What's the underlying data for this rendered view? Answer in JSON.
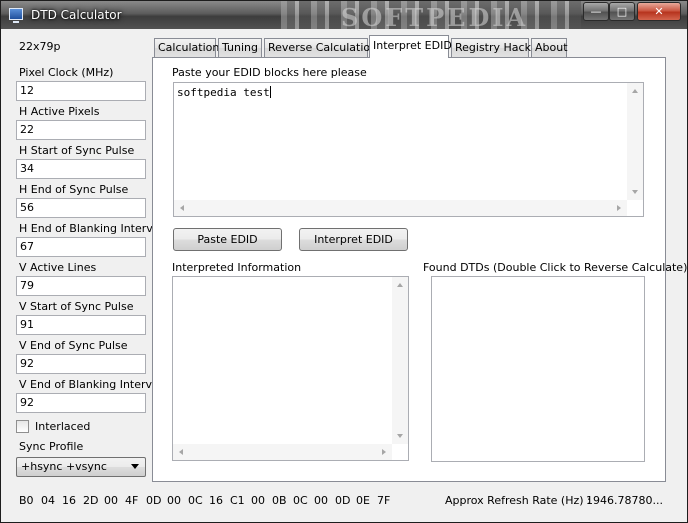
{
  "window": {
    "title": "DTD Calculator",
    "watermark": "SOFTPEDIA",
    "controls": {
      "minimize": "—",
      "maximize": "□",
      "close": "✕"
    }
  },
  "left_panel": {
    "mode_label": "22x79p",
    "fields": [
      {
        "label": "Pixel Clock (MHz)",
        "value": "12"
      },
      {
        "label": "H Active Pixels",
        "value": "22"
      },
      {
        "label": "H Start of Sync Pulse",
        "value": "34"
      },
      {
        "label": "H End of Sync Pulse",
        "value": "56"
      },
      {
        "label": "H End of Blanking Interval",
        "value": "67"
      },
      {
        "label": "V Active Lines",
        "value": "79"
      },
      {
        "label": "V Start of Sync Pulse",
        "value": "91"
      },
      {
        "label": "V End of Sync Pulse",
        "value": "92"
      },
      {
        "label": "V End of Blanking Interval",
        "value": "92"
      }
    ],
    "interlaced_label": "Interlaced",
    "interlaced_checked": false,
    "sync_profile_label": "Sync Profile",
    "sync_profile_value": "+hsync +vsync"
  },
  "tabs": [
    {
      "label": "Calculation",
      "active": false
    },
    {
      "label": "Tuning",
      "active": false
    },
    {
      "label": "Reverse Calculation",
      "active": false
    },
    {
      "label": "Interpret EDID",
      "active": true
    },
    {
      "label": "Registry Hack",
      "active": false
    },
    {
      "label": "About",
      "active": false
    }
  ],
  "edid_panel": {
    "prompt": "Paste your EDID blocks here please",
    "edid_text": "softpedia test",
    "paste_button": "Paste EDID",
    "interpret_button": "Interpret EDID",
    "interpreted_label": "Interpreted Information",
    "found_label": "Found DTDs (Double Click to Reverse Calculate)"
  },
  "status_bar": {
    "hex_bytes": [
      "B0",
      "04",
      "16",
      "2D",
      "00",
      "4F",
      "0D",
      "00",
      "0C",
      "16",
      "C1",
      "00",
      "0B",
      "0C",
      "00",
      "0D",
      "0E",
      "7F"
    ],
    "refresh_label": "Approx Refresh Rate (Hz) :",
    "refresh_value": "1946.78780..."
  }
}
